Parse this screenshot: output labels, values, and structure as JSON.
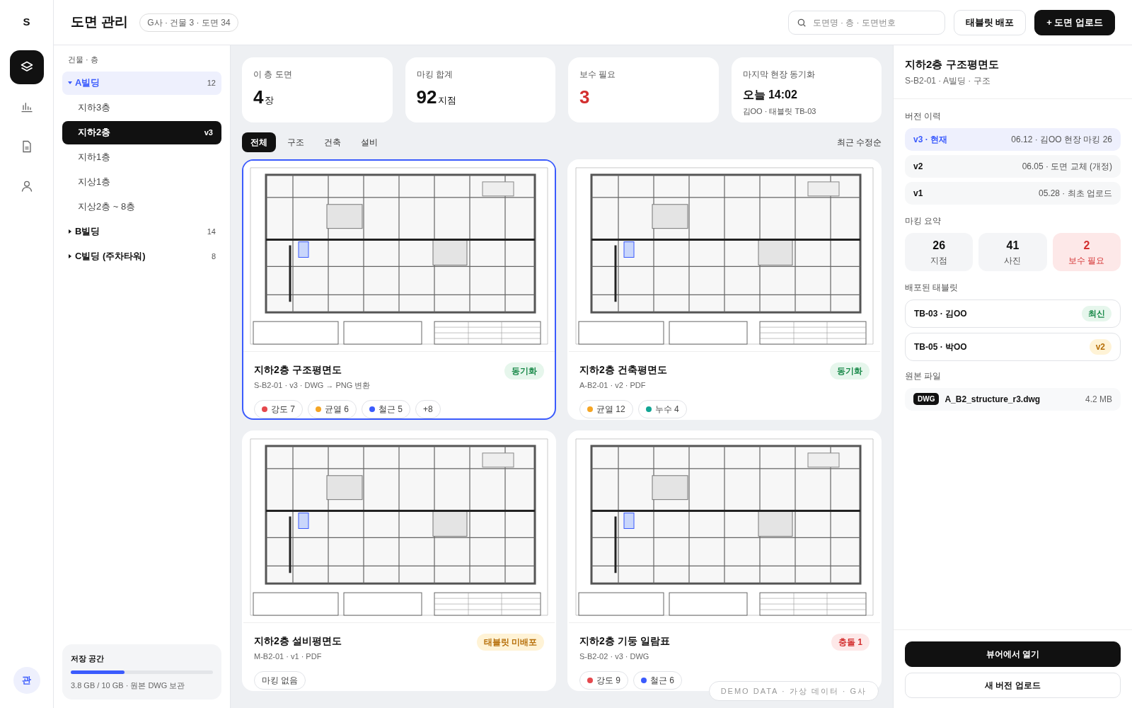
{
  "rail": {
    "logo": "S",
    "items": [
      {
        "kind": "layers",
        "selected": true
      },
      {
        "kind": "chart",
        "selected": false
      },
      {
        "kind": "document",
        "selected": false
      },
      {
        "kind": "user",
        "selected": false
      }
    ],
    "avatar": "관"
  },
  "header": {
    "title": "도면 관리",
    "badge": "G사 · 건물 3 · 도면 34",
    "search": {
      "placeholder": "도면명 · 층 · 도면번호"
    },
    "buttons": [
      {
        "label": "태블릿 배포",
        "kind": "secondary"
      },
      {
        "label": "+ 도면 업로드",
        "kind": "primary"
      }
    ]
  },
  "sidebar": {
    "heading": "건물 · 층",
    "buildings": [
      {
        "label": "A빌딩",
        "count": "12",
        "expanded": true,
        "selected": true,
        "children": [
          {
            "label": "지하3층",
            "selected": false
          },
          {
            "label": "지하2층",
            "selected": true,
            "badge": "v3"
          },
          {
            "label": "지하1층",
            "selected": false
          },
          {
            "label": "지상1층",
            "selected": false
          },
          {
            "label": "지상2층 ~ 8층",
            "selected": false
          }
        ]
      },
      {
        "label": "B빌딩",
        "count": "14",
        "expanded": false,
        "selected": false
      },
      {
        "label": "C빌딩 (주차타워)",
        "count": "8",
        "expanded": false,
        "selected": false
      }
    ],
    "storage": {
      "title": "저장 공간",
      "level": 0.38,
      "caption": "3.8 GB / 10 GB · 원본 DWG 보관"
    }
  },
  "stats": [
    {
      "label": "이 층 도면",
      "value": "4",
      "unit": "장",
      "kind": "normal"
    },
    {
      "label": "마킹 합계",
      "value": "92",
      "unit": "지점",
      "kind": "normal"
    },
    {
      "label": "보수 필요",
      "value": "3",
      "kind": "alert"
    },
    {
      "label": "마지막 현장 동기화",
      "value": "오늘 14:02",
      "caption": "김OO · 태블릿 TB-03",
      "kind": "time"
    }
  ],
  "tabs": [
    {
      "label": "전체",
      "selected": true
    },
    {
      "label": "구조",
      "selected": false
    },
    {
      "label": "건축",
      "selected": false
    },
    {
      "label": "설비",
      "selected": false
    }
  ],
  "sort": "최근 수정순",
  "cards": [
    {
      "title": "지하2층 구조평면도",
      "subtitle": "S-B2-01 · v3 · DWG → PNG 변환",
      "status": {
        "label": "동기화",
        "kind": "sync"
      },
      "selected": true,
      "tags": [
        {
          "label": "강도 7",
          "kind": "dot",
          "color": "#e5484d"
        },
        {
          "label": "균열 6",
          "kind": "dot",
          "color": "#f5a524"
        },
        {
          "label": "철근 5",
          "kind": "dot",
          "color": "#3b5bfd"
        },
        {
          "label": "+8",
          "kind": "more"
        }
      ]
    },
    {
      "title": "지하2층 건축평면도",
      "subtitle": "A-B2-01 · v2 · PDF",
      "status": {
        "label": "동기화",
        "kind": "sync"
      },
      "selected": false,
      "tags": [
        {
          "label": "균열 12",
          "kind": "dot",
          "color": "#f5a524"
        },
        {
          "label": "누수 4",
          "kind": "dot",
          "color": "#12a594"
        }
      ]
    },
    {
      "title": "지하2층 설비평면도",
      "subtitle": "M-B2-01 · v1 · PDF",
      "status": {
        "label": "태블릿 미배포",
        "kind": "warn"
      },
      "selected": false,
      "tags": [
        {
          "label": "마킹 없음",
          "kind": "empty"
        }
      ]
    },
    {
      "title": "지하2층 기둥 일람표",
      "subtitle": "S-B2-02 · v3 · DWG",
      "status": {
        "label": "충돌 1",
        "kind": "conflict"
      },
      "selected": false,
      "tags": [
        {
          "label": "강도 9",
          "kind": "dot",
          "color": "#e5484d"
        },
        {
          "label": "철근 6",
          "kind": "dot",
          "color": "#3b5bfd"
        }
      ]
    }
  ],
  "demo_badge": "DEMO DATA · 가상 데이터 · G사",
  "detail": {
    "title": "지하2층 구조평면도",
    "subtitle": "S-B2-01 · A빌딩 · 구조",
    "versions_heading": "버전 이력",
    "versions": [
      {
        "label": "v3 · 현재",
        "note": "06.12 · 김OO 현장 마킹 26",
        "selected": true
      },
      {
        "label": "v2",
        "note": "06.05 · 도면 교체 (개정)",
        "selected": false
      },
      {
        "label": "v1",
        "note": "05.28 · 최초 업로드",
        "selected": false
      }
    ],
    "summary_heading": "마킹 요약",
    "summary": [
      {
        "value": "26",
        "label": "지점",
        "kind": "normal"
      },
      {
        "value": "41",
        "label": "사진",
        "kind": "normal"
      },
      {
        "value": "2",
        "label": "보수 필요",
        "kind": "alert"
      }
    ],
    "tablets_heading": "배포된 태블릿",
    "tablets": [
      {
        "label": "TB-03 · 김OO",
        "badge": "최신",
        "kind": "latest"
      },
      {
        "label": "TB-05 · 박OO",
        "badge": "v2",
        "kind": "outdated"
      }
    ],
    "file_heading": "원본 파일",
    "file": {
      "type": "DWG",
      "name": "A_B2_structure_r3.dwg",
      "size": "4.2 MB"
    },
    "buttons": [
      {
        "label": "뷰어에서 열기",
        "kind": "primary"
      },
      {
        "label": "새 버전 업로드",
        "kind": "secondary"
      }
    ]
  }
}
